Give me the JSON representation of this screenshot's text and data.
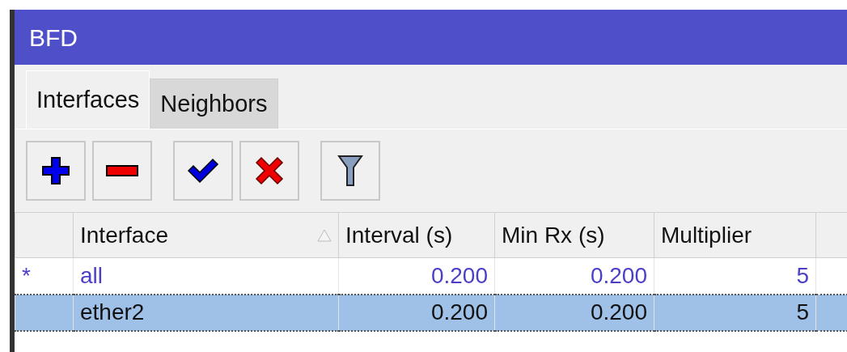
{
  "window": {
    "title": "BFD"
  },
  "tabs": [
    {
      "label": "Interfaces",
      "selected": true
    },
    {
      "label": "Neighbors",
      "selected": false
    }
  ],
  "toolbar": [
    {
      "kind": "add"
    },
    {
      "kind": "remove"
    },
    {
      "kind": "enable"
    },
    {
      "kind": "disable"
    },
    {
      "kind": "filter"
    }
  ],
  "table": {
    "columns": [
      {
        "label": "Interface",
        "sorted": true
      },
      {
        "label": "Interval (s)",
        "sorted": false
      },
      {
        "label": "Min Rx (s)",
        "sorted": false
      },
      {
        "label": "Multiplier",
        "sorted": false
      }
    ],
    "rows": [
      {
        "marker": "*",
        "kind": "default",
        "selected": false,
        "cells": [
          "all",
          "0.200",
          "0.200",
          "5"
        ]
      },
      {
        "marker": "",
        "kind": "normal",
        "selected": true,
        "cells": [
          "ether2",
          "0.200",
          "0.200",
          "5"
        ]
      }
    ]
  }
}
